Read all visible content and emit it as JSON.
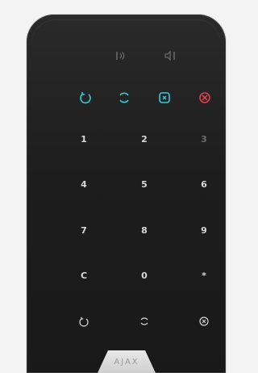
{
  "device": {
    "brand_logo": "AJAX",
    "status_indicators": [
      {
        "icon": "disarm-icon",
        "color": "#37c8d6"
      },
      {
        "icon": "arm-icon",
        "color": "#37c8d6"
      },
      {
        "icon": "night-mode-icon",
        "color": "#37c8d6"
      },
      {
        "icon": "alert-icon",
        "color": "#e0404a"
      }
    ],
    "keys": {
      "row1": [
        "1",
        "2",
        "3"
      ],
      "row2": [
        "4",
        "5",
        "6"
      ],
      "row3": [
        "7",
        "8",
        "9"
      ],
      "row4": [
        "C",
        "0",
        "*"
      ]
    },
    "bottom_buttons": [
      "disarm-icon",
      "arm-icon",
      "panic-icon"
    ]
  }
}
